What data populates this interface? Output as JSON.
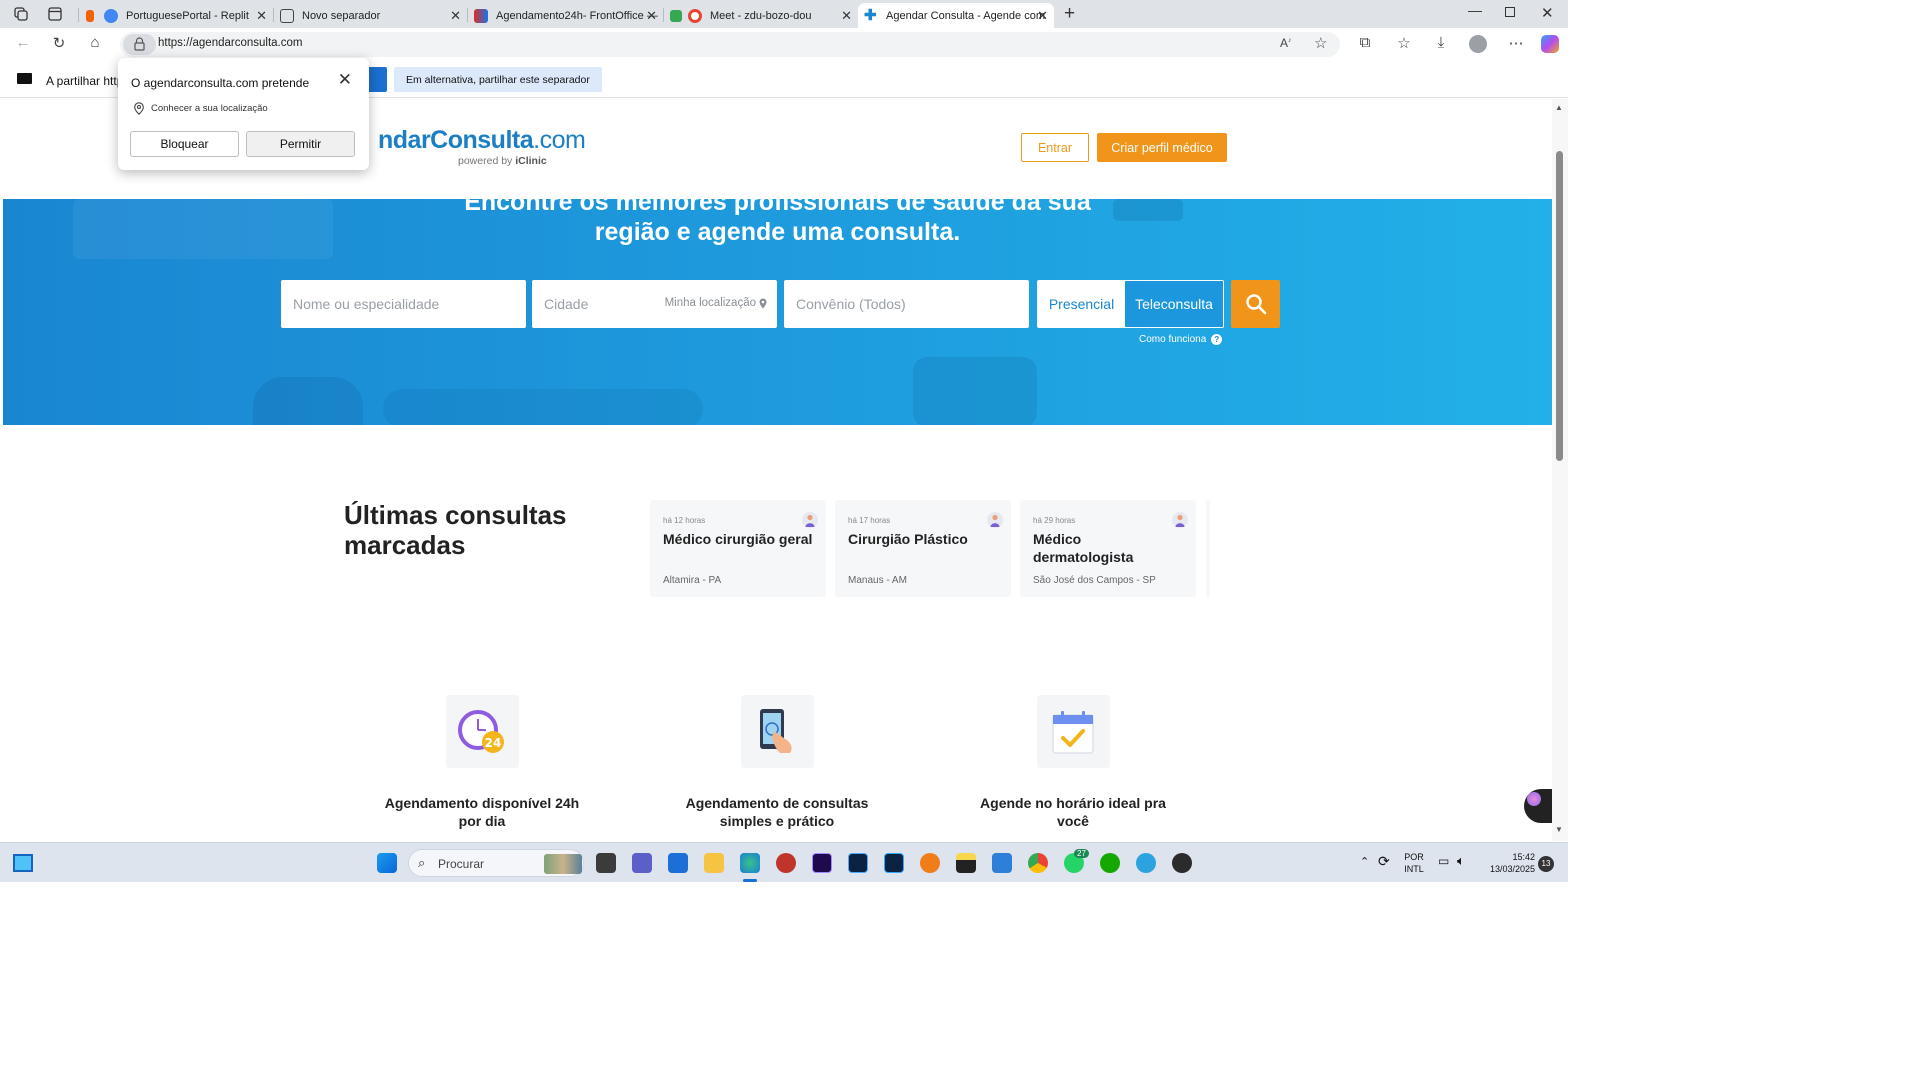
{
  "browser": {
    "tabs": [
      {
        "title": "PortuguesePortal - Replit",
        "color": "#4285f4"
      },
      {
        "title": "Novo separador",
        "color": "#555555"
      },
      {
        "title": "Agendamento24h- FrontOffice —",
        "color": "#d93025"
      },
      {
        "title": "Meet - zdu-bozo-dou",
        "color": "#ea4335"
      },
      {
        "title": "Agendar Consulta - Agende com",
        "color": "#1a86d2"
      }
    ],
    "url": "https://agendarconsulta.com"
  },
  "sharebar": {
    "text": "A partilhar http",
    "share_btn": "a",
    "alt_btn": "Em alternativa, partilhar este separador"
  },
  "popup": {
    "title": "O agendarconsulta.com pretende",
    "permission": "Conhecer a sua localização",
    "block": "Bloquear",
    "allow": "Permitir"
  },
  "header": {
    "logo_main": "ndarConsulta",
    "logo_com": ".com",
    "logo_powered": "powered by ",
    "logo_brand": "iClinic",
    "login": "Entrar",
    "create_profile": "Criar perfil médico"
  },
  "hero": {
    "title_line1": "Encontre os melhores profissionais de saúde da sua",
    "title_line2": "região e agende uma consulta.",
    "name_placeholder": "Nome ou especialidade",
    "city_placeholder": "Cidade",
    "my_location": "Minha localização",
    "insurance_placeholder": "Convênio (Todos)",
    "presencial": "Presencial",
    "teleconsulta": "Teleconsulta",
    "how_it_works": "Como funciona"
  },
  "latest": {
    "title": "Últimas consultas marcadas",
    "cards": [
      {
        "ago": "há 12 horas",
        "specialty": "Médico cirurgião geral",
        "location": "Altamira - PA"
      },
      {
        "ago": "há 17 horas",
        "specialty": "Cirurgião Plástico",
        "location": "Manaus - AM"
      },
      {
        "ago": "há 29 horas",
        "specialty": "Médico dermatologista",
        "location": "São José dos Campos - SP"
      }
    ]
  },
  "features": [
    {
      "label": "Agendamento disponível 24h por dia",
      "icon": "clock-24-icon"
    },
    {
      "label": "Agendamento de consultas simples e prático",
      "icon": "phone-touch-icon"
    },
    {
      "label": "Agende no horário ideal pra você",
      "icon": "calendar-check-icon"
    }
  ],
  "taskbar": {
    "search": "Procurar",
    "lang_top": "POR",
    "lang_bottom": "INTL",
    "time": "15:42",
    "date": "13/03/2025",
    "notifications": "13",
    "whatsapp_badge": "27"
  },
  "colors": {
    "brand_blue": "#1a86d2",
    "accent_orange": "#f0951a"
  }
}
